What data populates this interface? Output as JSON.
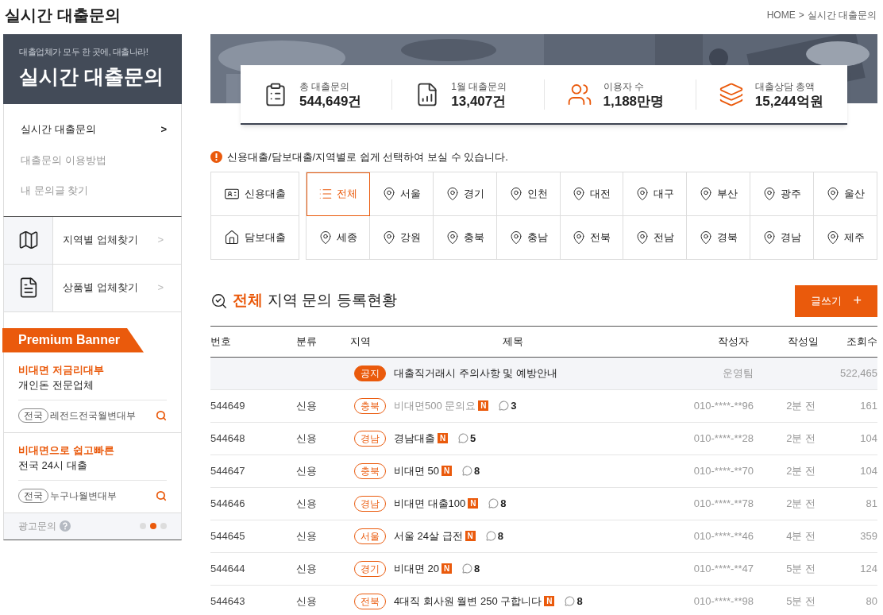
{
  "page_title": "실시간 대출문의",
  "breadcrumb": {
    "home": "HOME",
    "separator": ">",
    "current": "실시간 대출문의"
  },
  "sidebar": {
    "tagline": "대출업체가 모두 한 곳에, 대출나라!",
    "heading": "실시간 대출문의",
    "menu": [
      {
        "label": "실시간 대출문의",
        "selected": true,
        "arrow": ">"
      },
      {
        "label": "대출문의 이용방법",
        "selected": false
      },
      {
        "label": "내 문의글 찾기",
        "selected": false
      }
    ],
    "finders": [
      {
        "kind": "region",
        "label": "지역별 업체찾기",
        "arrow": ">"
      },
      {
        "kind": "product",
        "label": "상품별 업체찾기",
        "arrow": ">"
      }
    ],
    "premium": {
      "title": "Premium Banner",
      "ads": [
        {
          "headline": "비대면 저금리대부",
          "subline": "개인돈 전문업체",
          "tag": "전국",
          "company": "레전드전국월변대부"
        },
        {
          "headline": "비대면으로 쉽고빠른",
          "subline": "전국 24시 대출",
          "tag": "전국",
          "company": "누구나월변대부"
        }
      ],
      "footer": "광고문의",
      "dots": [
        {
          "selected": false
        },
        {
          "selected": true
        },
        {
          "selected": false
        }
      ]
    }
  },
  "stats": [
    {
      "kind": "clipboard",
      "label": "총 대출문의",
      "value": "544,649건"
    },
    {
      "kind": "chart",
      "label": "1월 대출문의",
      "value": "13,407건"
    },
    {
      "kind": "users",
      "label": "이용자 수",
      "value": "1,188만명"
    },
    {
      "kind": "money",
      "label": "대출상담 총액",
      "value": "15,244억원"
    }
  ],
  "notice": "신용대출/담보대출/지역별로 쉽게 선택하여 보실 수 있습니다.",
  "loan_types": [
    {
      "kind": "credit",
      "label": "신용대출",
      "selected": false
    },
    {
      "kind": "mortgage",
      "label": "담보대출",
      "selected": false
    }
  ],
  "regions": [
    {
      "kind": "all",
      "label": "전체",
      "selected": true
    },
    {
      "kind": "region",
      "label": "서울",
      "selected": false
    },
    {
      "kind": "region",
      "label": "경기",
      "selected": false
    },
    {
      "kind": "region",
      "label": "인천",
      "selected": false
    },
    {
      "kind": "region",
      "label": "대전",
      "selected": false
    },
    {
      "kind": "region",
      "label": "대구",
      "selected": false
    },
    {
      "kind": "region",
      "label": "부산",
      "selected": false
    },
    {
      "kind": "region",
      "label": "광주",
      "selected": false
    },
    {
      "kind": "region",
      "label": "울산",
      "selected": false
    },
    {
      "kind": "region",
      "label": "세종",
      "selected": false
    },
    {
      "kind": "region",
      "label": "강원",
      "selected": false
    },
    {
      "kind": "region",
      "label": "충북",
      "selected": false
    },
    {
      "kind": "region",
      "label": "충남",
      "selected": false
    },
    {
      "kind": "region",
      "label": "전북",
      "selected": false
    },
    {
      "kind": "region",
      "label": "전남",
      "selected": false
    },
    {
      "kind": "region",
      "label": "경북",
      "selected": false
    },
    {
      "kind": "region",
      "label": "경남",
      "selected": false
    },
    {
      "kind": "region",
      "label": "제주",
      "selected": false
    }
  ],
  "board": {
    "title_highlight": "전체",
    "title_rest": "지역 문의 등록현황",
    "write_button": "글쓰기",
    "write_icon": "+",
    "columns": [
      "번호",
      "분류",
      "지역",
      "제목",
      "작성자",
      "작성일",
      "조회수"
    ],
    "rows": [
      {
        "kind": "notice",
        "number": "",
        "category": "",
        "region": "공지",
        "title": {
          "text": "대출직거래시 주의사항 및 예방안내",
          "read": false
        },
        "author": "운영팀",
        "date": "",
        "views": "522,465"
      },
      {
        "kind": "post",
        "number": "544649",
        "category": "신용",
        "region": "충북",
        "title": {
          "text": "비대면500 문의요",
          "new": "N",
          "comments": "3",
          "read": true
        },
        "author": "010-****-**96",
        "date": "2분 전",
        "views": "161"
      },
      {
        "kind": "post",
        "number": "544648",
        "category": "신용",
        "region": "경남",
        "title": {
          "text": "경남대출",
          "new": "N",
          "comments": "5",
          "read": false
        },
        "author": "010-****-**28",
        "date": "2분 전",
        "views": "104"
      },
      {
        "kind": "post",
        "number": "544647",
        "category": "신용",
        "region": "충북",
        "title": {
          "text": "비대면 50",
          "new": "N",
          "comments": "8",
          "read": false
        },
        "author": "010-****-**70",
        "date": "2분 전",
        "views": "104"
      },
      {
        "kind": "post",
        "number": "544646",
        "category": "신용",
        "region": "경남",
        "title": {
          "text": "비대면 대출100",
          "new": "N",
          "comments": "8",
          "read": false
        },
        "author": "010-****-**78",
        "date": "2분 전",
        "views": "81"
      },
      {
        "kind": "post",
        "number": "544645",
        "category": "신용",
        "region": "서울",
        "title": {
          "text": "서울 24살 급전",
          "new": "N",
          "comments": "8",
          "read": false
        },
        "author": "010-****-**46",
        "date": "4분 전",
        "views": "359"
      },
      {
        "kind": "post",
        "number": "544644",
        "category": "신용",
        "region": "경기",
        "title": {
          "text": "비대면 20",
          "new": "N",
          "comments": "8",
          "read": false
        },
        "author": "010-****-**47",
        "date": "5분 전",
        "views": "124"
      },
      {
        "kind": "post",
        "number": "544643",
        "category": "신용",
        "region": "전북",
        "title": {
          "text": "4대직 회사원 월변 250 구합니다",
          "new": "N",
          "comments": "8",
          "read": false
        },
        "author": "010-****-**98",
        "date": "5분 전",
        "views": "80"
      }
    ]
  }
}
